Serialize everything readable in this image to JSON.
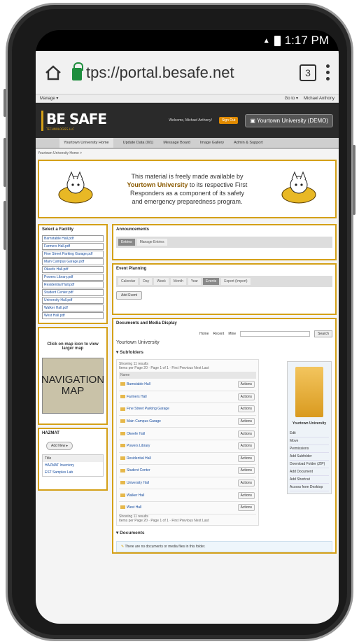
{
  "status": {
    "time": "1:17 PM",
    "signal": "4"
  },
  "browser": {
    "url": "tps://portal.besafe.net",
    "tab_count": "3"
  },
  "topstrip": {
    "manage": "Manage ▾",
    "goto": "Go to ▾",
    "user": "Michael Anthony"
  },
  "banner": {
    "logo": "BE SAFE",
    "logo_sub": "TECHNOLOGIES LLC",
    "welcome": "Welcome, Michael Anthony!",
    "signout": "Sign Out",
    "university_button": "Yourtown University (DEMO)"
  },
  "nav": [
    "Yourtown University Home",
    "Update Data (0/1)",
    "Message Board",
    "Image Gallery",
    "Admin & Support"
  ],
  "breadcrumb": "Yourtown University Home >",
  "hero": {
    "line1": "This material is freely made available by ",
    "bold": "Yourtown University",
    "line2": " to its respective First Responders as a component of its safety and emergency preparedness program."
  },
  "facility": {
    "title": "Select a Facility",
    "items": [
      "Barnstable Hall.pdf",
      "Farmers Hall.pdf",
      "Fine Street Parking Garage.pdf",
      "Main Campus Garage.pdf",
      "Okeefe Hall.pdf",
      "Powers Library.pdf",
      "Residential Hall.pdf",
      "Student Center.pdf",
      "University Hall.pdf",
      "Walker Hall.pdf",
      "West Hall.pdf"
    ]
  },
  "map": {
    "caption": "Click on map icon to view larger map",
    "image_label_1": "NAVIGATION",
    "image_label_2": "MAP"
  },
  "hazmat": {
    "title": "HAZMAT",
    "add_button": "Add New ▸",
    "col_title": "Title",
    "row1": "HAZMAT Inventory",
    "row2": "EST Samples Lab"
  },
  "announcements": {
    "title": "Announcements",
    "tabs": [
      "Entries",
      "Manage Entries"
    ]
  },
  "events": {
    "title": "Event Planning",
    "tabs": [
      "Calendar",
      "Day",
      "Week",
      "Month",
      "Year",
      "Events",
      "Export (Import)"
    ],
    "add_button": "Add Event"
  },
  "documents": {
    "title": "Documents and Media Display",
    "toolbar": {
      "home": "Home",
      "recent": "Recent",
      "mine": "Mine",
      "search": "Search"
    },
    "folder_title": "Yourtown University",
    "subfolders_heading": "Subfolders",
    "showing": "Showing 11 results",
    "items_per_page": "Items per Page 20",
    "page": "Page 1 of 1",
    "pager": "First  Previous  Next  Last",
    "col_name": "Name",
    "rows": [
      "Barnstable Hall",
      "Farmers Hall",
      "Fine Street Parking Garage",
      "Main Campus Garage",
      "Okeefe Hall",
      "Powers Library",
      "Residential Hall",
      "Student Center",
      "University Hall",
      "Walker Hall",
      "West Hall"
    ],
    "action_label": "Actions",
    "documents_heading": "Documents",
    "no_docs": "There are no documents or media files in this folder."
  },
  "side_panel": {
    "title": "Yourtown University",
    "items": [
      "Edit",
      "Move",
      "Permissions",
      "Add Subfolder",
      "Download Folder (ZIP)",
      "Add Document",
      "Add Shortcut",
      "Access from Desktop"
    ]
  }
}
